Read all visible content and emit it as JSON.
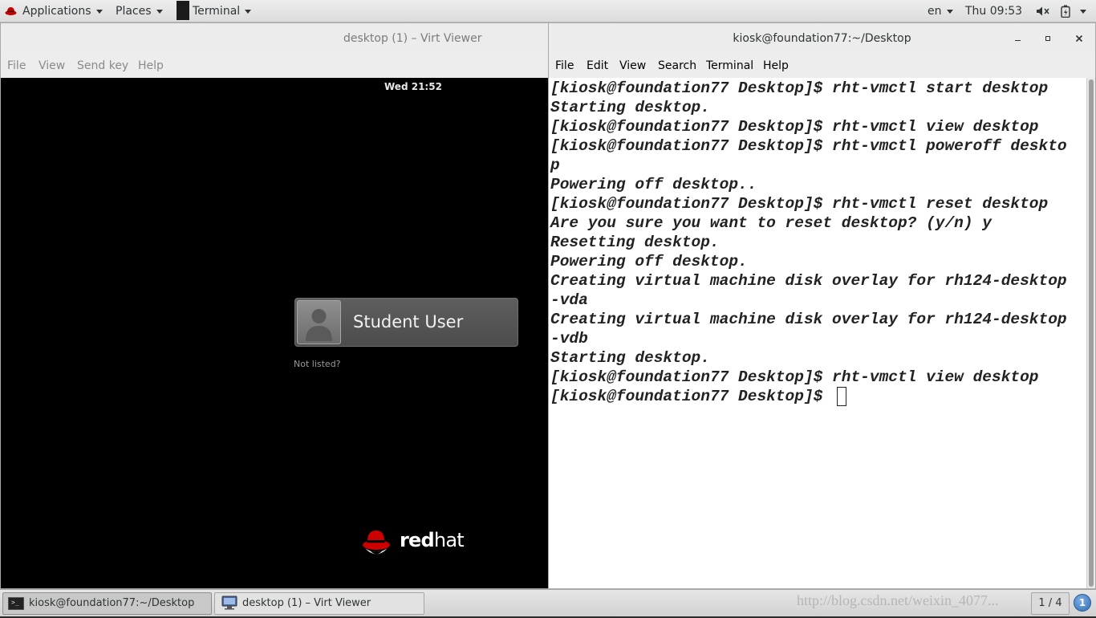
{
  "top_panel": {
    "applications": "Applications",
    "places": "Places",
    "active_app": "Terminal",
    "language": "en",
    "clock": "Thu 09:53"
  },
  "virt_viewer": {
    "title": "desktop (1) – Virt Viewer",
    "menu": [
      "File",
      "View",
      "Send key",
      "Help"
    ],
    "guest": {
      "clock": "Wed 21:52",
      "user_name": "Student User",
      "not_listed": "Not listed?",
      "logo_text_red": "red",
      "logo_text_hat": "hat"
    }
  },
  "terminal": {
    "title": "kiosk@foundation77:~/Desktop",
    "menu": [
      "File",
      "Edit",
      "View",
      "Search",
      "Terminal",
      "Help"
    ],
    "lines": [
      "[kiosk@foundation77 Desktop]$ rht-vmctl start desktop",
      "Starting desktop.",
      "[kiosk@foundation77 Desktop]$ rht-vmctl view desktop",
      "[kiosk@foundation77 Desktop]$ rht-vmctl poweroff deskto",
      "p",
      "Powering off desktop..",
      "[kiosk@foundation77 Desktop]$ rht-vmctl reset desktop",
      "Are you sure you want to reset desktop? (y/n) y",
      "Resetting desktop.",
      "Powering off desktop.",
      "Creating virtual machine disk overlay for rh124-desktop",
      "-vda",
      "Creating virtual machine disk overlay for rh124-desktop",
      "-vdb",
      "Starting desktop.",
      "[kiosk@foundation77 Desktop]$ rht-vmctl view desktop",
      "[kiosk@foundation77 Desktop]$ "
    ]
  },
  "taskbar": {
    "tasks": [
      "kiosk@foundation77:~/Desktop",
      "desktop (1) – Virt Viewer"
    ],
    "workspace": "1 / 4",
    "notification_count": "1",
    "watermark": "http://blog.csdn.net/weixin_4077..."
  },
  "colors": {
    "redhat_red": "#cc0000",
    "panel": "#e3e3e3",
    "notification_blue": "#3f7fc4"
  },
  "icons": [
    "redhat-fedora-icon",
    "terminal-icon",
    "volume-muted-icon",
    "battery-icon",
    "minimize-icon",
    "maximize-icon",
    "close-icon",
    "user-avatar-icon",
    "virt-viewer-icon",
    "notification-icon"
  ]
}
